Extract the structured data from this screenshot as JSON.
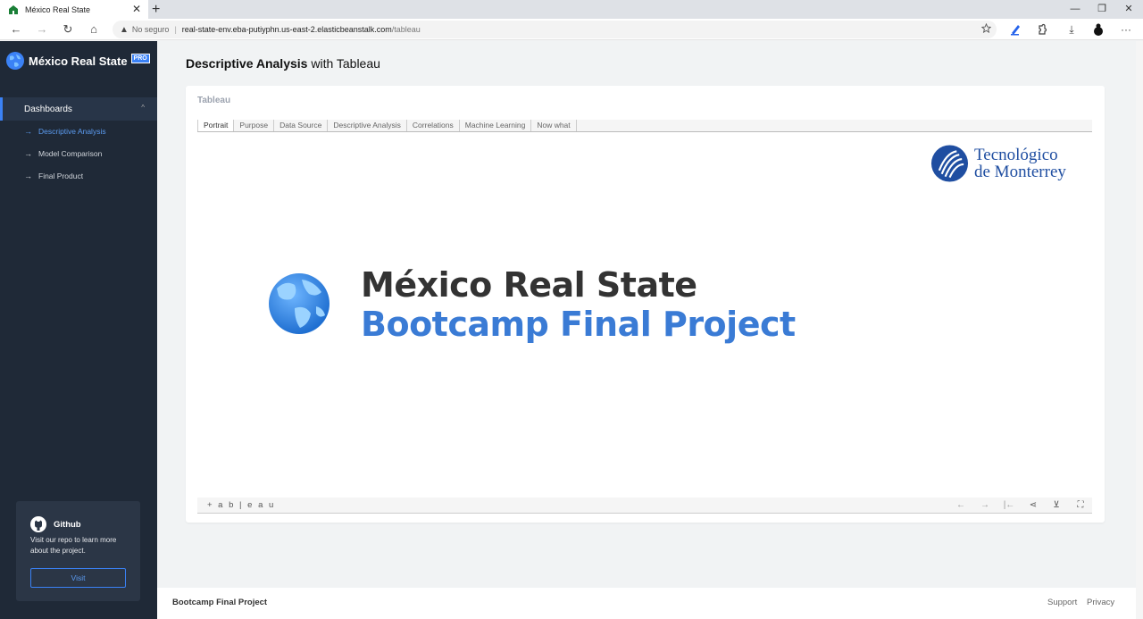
{
  "browser": {
    "tab_title": "México Real State",
    "tab_close": "✕",
    "new_tab": "+",
    "minimize": "—",
    "restore": "❐",
    "close": "✕",
    "back": "←",
    "forward": "→",
    "reload": "↻",
    "home": "⌂",
    "address": {
      "warning": "▲",
      "insecure_label": "No seguro",
      "separator": "|",
      "host": "real-state-env.eba-putiyphn.us-east-2.elasticbeanstalk.com",
      "path": "/tableau"
    },
    "more": "···",
    "download": "⤓"
  },
  "sidebar": {
    "brand_name": "México Real State",
    "brand_badge": "PRO",
    "section_label": "Dashboards",
    "section_chevron": "^",
    "item_arrow": "→",
    "items": [
      {
        "label": "Descriptive Analysis",
        "active": true
      },
      {
        "label": "Model Comparison",
        "active": false
      },
      {
        "label": "Final Product",
        "active": false
      }
    ],
    "github": {
      "title": "Github",
      "text": "Visit our repo to learn more about the project.",
      "button": "Visit"
    }
  },
  "main": {
    "title_bold": "Descriptive Analysis",
    "title_rest": " with Tableau",
    "card_title": "Tableau",
    "tabs": [
      "Portrait",
      "Purpose",
      "Data Source",
      "Descriptive Analysis",
      "Correlations",
      "Machine Learning",
      "Now what"
    ],
    "selected_tab": "Portrait",
    "institution_line1": "Tecnológico",
    "institution_line2": "de Monterrey",
    "hero_line1": "México Real State",
    "hero_line2": "Bootcamp Final Project",
    "tableau_logo": "+ a b | e a u",
    "controls": {
      "undo": "←",
      "redo": "→",
      "revert": "|←",
      "share": "⋖",
      "download": "⊻",
      "fullscreen": "⛶"
    }
  },
  "footer": {
    "left": "Bootcamp Final Project",
    "support": "Support",
    "privacy": "Privacy"
  },
  "colors": {
    "accent": "#3b82f6",
    "sidebar_bg": "#1f2937",
    "hero_blue": "#3a7bd5",
    "itesm_blue": "#1f4ea1"
  }
}
